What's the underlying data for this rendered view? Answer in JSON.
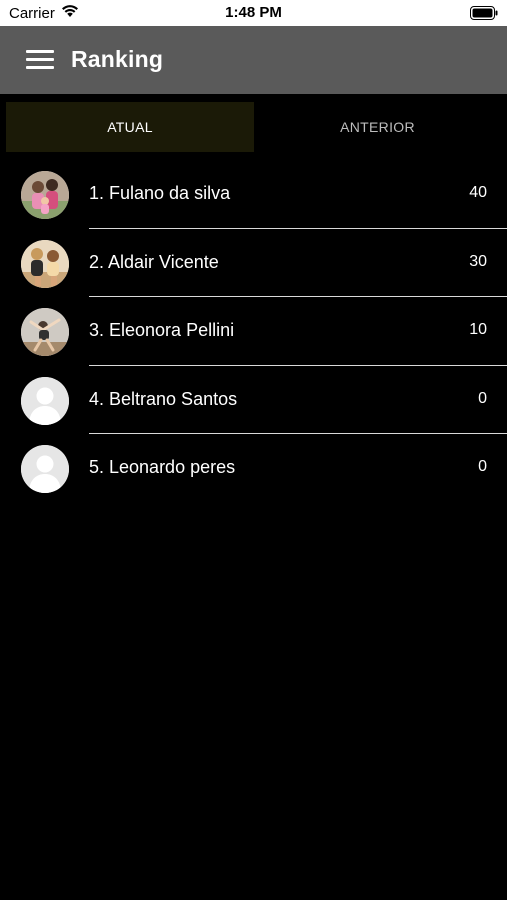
{
  "status_bar": {
    "carrier": "Carrier",
    "time": "1:48 PM",
    "icons": [
      "wifi-icon",
      "battery-icon"
    ]
  },
  "app_bar": {
    "title": "Ranking",
    "menu_icon": "hamburger-menu-icon"
  },
  "tabs": [
    {
      "label": "ATUAL",
      "active": true
    },
    {
      "label": "ANTERIOR",
      "active": false
    }
  ],
  "ranking": [
    {
      "name": "1. Fulano da silva",
      "score": "40",
      "avatar": "photo"
    },
    {
      "name": "2. Aldair Vicente",
      "score": "30",
      "avatar": "photo"
    },
    {
      "name": "3. Eleonora Pellini",
      "score": "10",
      "avatar": "photo"
    },
    {
      "name": "4. Beltrano Santos",
      "score": "0",
      "avatar": "placeholder"
    },
    {
      "name": "5. Leonardo peres",
      "score": "0",
      "avatar": "placeholder"
    }
  ],
  "colors": {
    "app_bar": "#5a5a5a",
    "background": "#000000",
    "active_tab": "#1b1a07",
    "divider": "#d9d9d9"
  }
}
